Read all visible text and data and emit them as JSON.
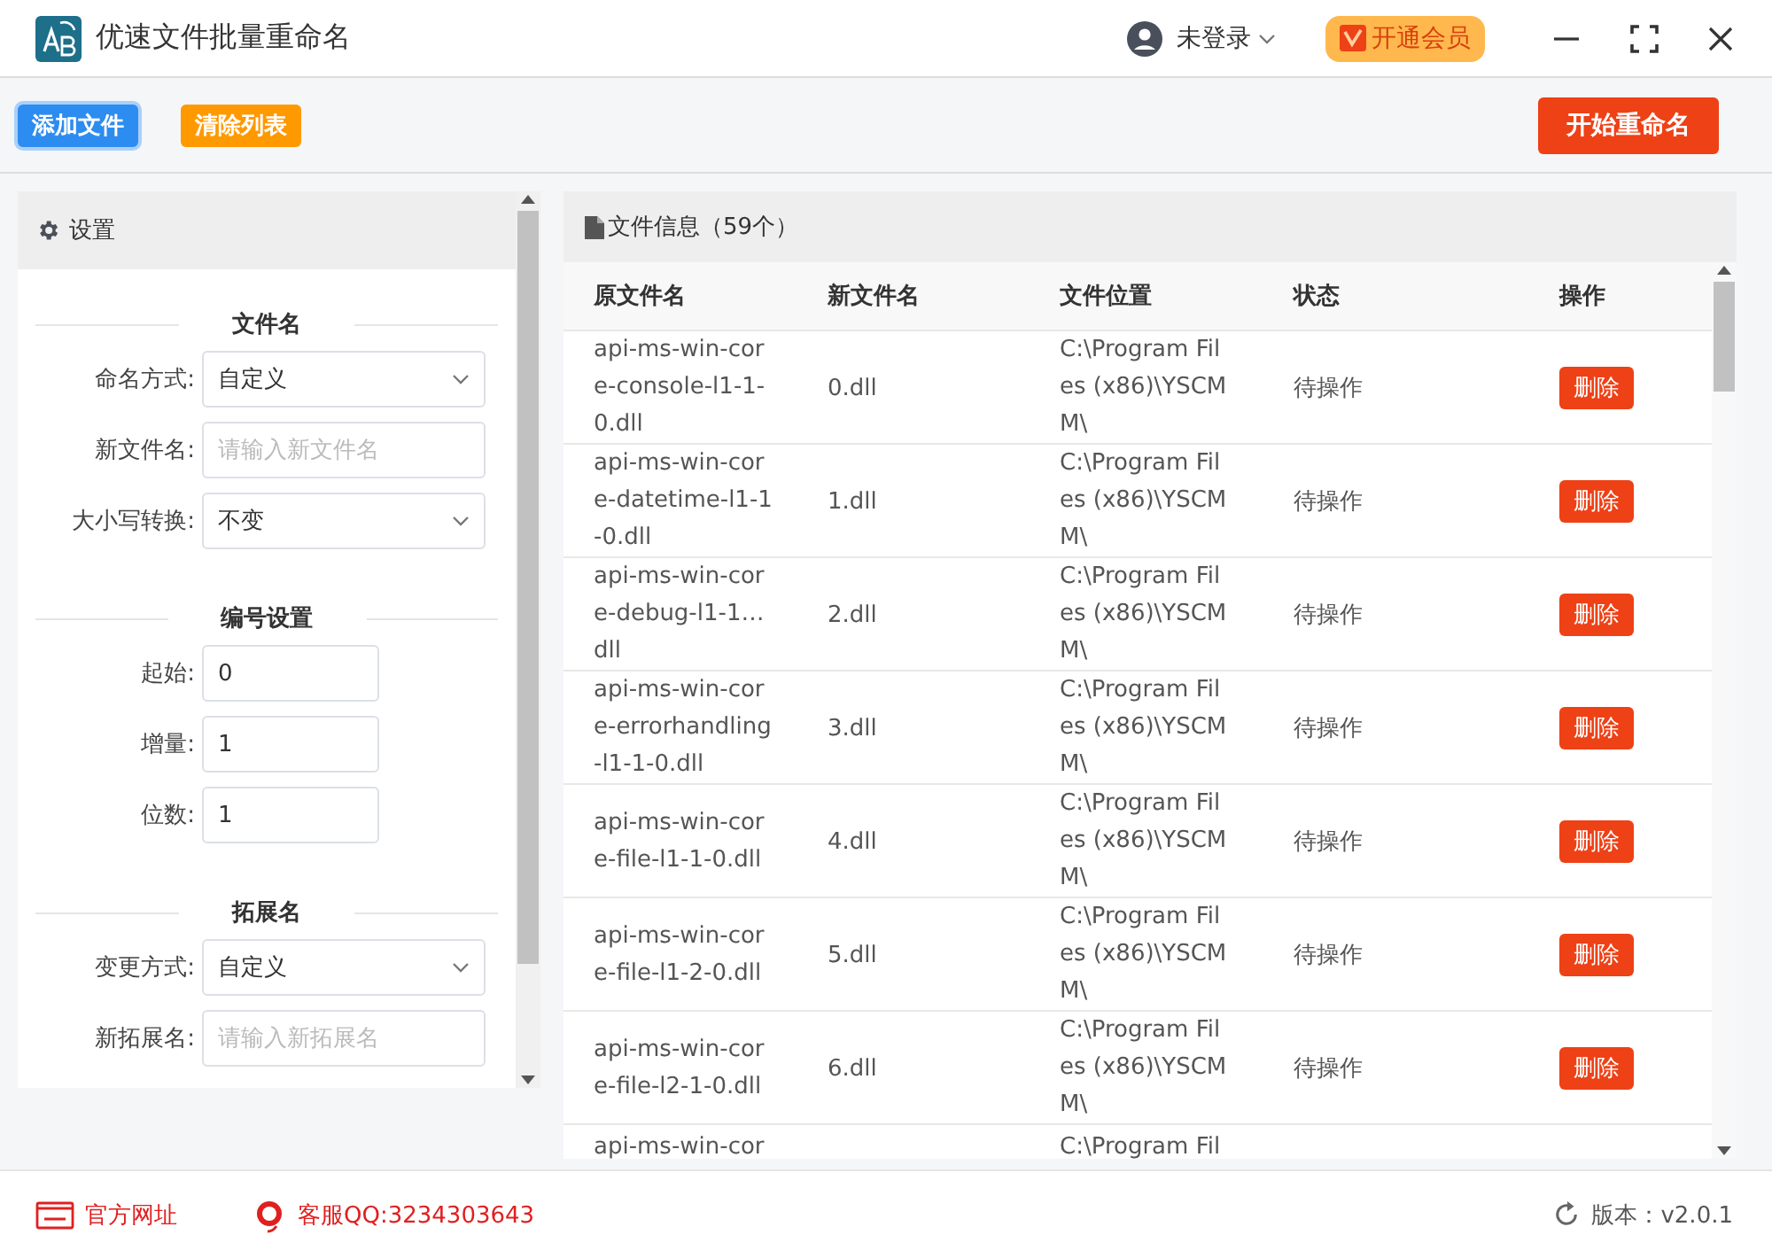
{
  "window": {
    "title": "优速文件批量重命名",
    "user": "未登录",
    "vip_button": "开通会员"
  },
  "toolbar": {
    "add_button": "添加文件",
    "clear_button": "清除列表",
    "start_button": "开始重命名"
  },
  "settings": {
    "title": "设置",
    "sections": [
      {
        "title": "文件名",
        "fields": [
          {
            "kind": "select",
            "label": "命名方式:",
            "value": "自定义"
          },
          {
            "kind": "input",
            "label": "新文件名:",
            "placeholder": "请输入新文件名"
          },
          {
            "kind": "select",
            "label": "大小写转换:",
            "value": "不变"
          }
        ]
      },
      {
        "title": "编号设置",
        "fields": [
          {
            "kind": "number",
            "label": "起始:",
            "value": "0"
          },
          {
            "kind": "number",
            "label": "增量:",
            "value": "1"
          },
          {
            "kind": "number",
            "label": "位数:",
            "value": "1"
          }
        ]
      },
      {
        "title": "拓展名",
        "fields": [
          {
            "kind": "select",
            "label": "变更方式:",
            "value": "自定义"
          },
          {
            "kind": "input",
            "label": "新拓展名:",
            "placeholder": "请输入新拓展名"
          }
        ]
      }
    ]
  },
  "files": {
    "title": "文件信息（59个）",
    "columns": [
      "原文件名",
      "新文件名",
      "文件位置",
      "状态",
      "操作"
    ],
    "rows": [
      {
        "original": "api-ms-win-cor\ne-console-l1-1-\n0.dll",
        "new": "0.dll",
        "location": "C:\\Program Fil\nes (x86)\\YSCM\nM\\",
        "status": "待操作",
        "action": "删除"
      },
      {
        "original": "api-ms-win-cor\ne-datetime-l1-1\n-0.dll",
        "new": "1.dll",
        "location": "C:\\Program Fil\nes (x86)\\YSCM\nM\\",
        "status": "待操作",
        "action": "删除"
      },
      {
        "original": "api-ms-win-cor\ne-debug-l1-1…\ndll",
        "new": "2.dll",
        "location": "C:\\Program Fil\nes (x86)\\YSCM\nM\\",
        "status": "待操作",
        "action": "删除"
      },
      {
        "original": "api-ms-win-cor\ne-errorhandling\n-l1-1-0.dll",
        "new": "3.dll",
        "location": "C:\\Program Fil\nes (x86)\\YSCM\nM\\",
        "status": "待操作",
        "action": "删除"
      },
      {
        "original": "api-ms-win-cor\ne-file-l1-1-0.dll",
        "new": "4.dll",
        "location": "C:\\Program Fil\nes (x86)\\YSCM\nM\\",
        "status": "待操作",
        "action": "删除"
      },
      {
        "original": "api-ms-win-cor\ne-file-l1-2-0.dll",
        "new": "5.dll",
        "location": "C:\\Program Fil\nes (x86)\\YSCM\nM\\",
        "status": "待操作",
        "action": "删除"
      },
      {
        "original": "api-ms-win-cor\ne-file-l2-1-0.dll",
        "new": "6.dll",
        "location": "C:\\Program Fil\nes (x86)\\YSCM\nM\\",
        "status": "待操作",
        "action": "删除"
      },
      {
        "original": "api-ms-win-cor",
        "location": "C:\\Program Fil"
      }
    ]
  },
  "footer": {
    "website": "官方网址",
    "support": "客服QQ:3234303643",
    "version": "版本：v2.0.1"
  }
}
